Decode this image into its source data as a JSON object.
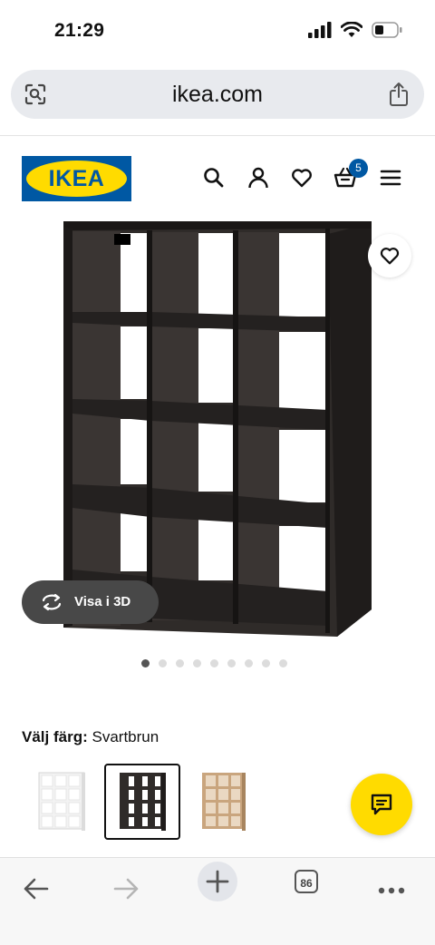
{
  "status_bar": {
    "time": "21:29",
    "icons": [
      "signal-icon",
      "wifi-icon",
      "battery-icon"
    ]
  },
  "browser": {
    "url": "ikea.com",
    "left_icon": "page-scan-icon",
    "right_icon": "share-icon"
  },
  "header": {
    "logo_text": "IKEA",
    "icons": [
      "search-icon",
      "account-icon",
      "heart-icon",
      "cart-icon",
      "menu-icon"
    ],
    "cart_count": "5",
    "brand_colors": {
      "blue": "#0058a3",
      "yellow": "#ffdb00"
    }
  },
  "gallery": {
    "view_3d_label": "Visa i 3D",
    "image_count": 9,
    "active_index": 0
  },
  "color_picker": {
    "label": "Välj färg:",
    "selected_value": "Svartbrun",
    "options": [
      {
        "name": "white",
        "color": "#f2f2f2"
      },
      {
        "name": "black-brown",
        "color": "#3a3533",
        "selected": true
      },
      {
        "name": "oak",
        "color": "#c9a57e"
      }
    ]
  },
  "chat_icon": "chat-icon",
  "bottom_toolbar": {
    "items": [
      "back-icon",
      "forward-icon",
      "new-tab-icon",
      "tabs-icon",
      "more-icon"
    ],
    "tab_count": "86"
  }
}
